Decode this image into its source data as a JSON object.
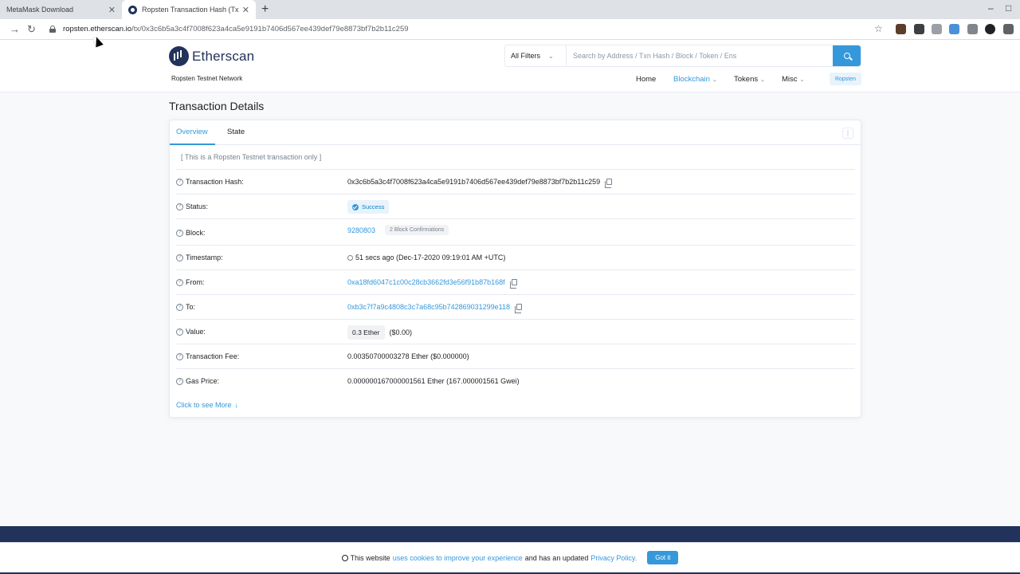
{
  "browser": {
    "tabs": [
      {
        "title": "MetaMask Download",
        "active": false
      },
      {
        "title": "Ropsten Transaction Hash (Txhas",
        "active": true
      }
    ],
    "url_host": "ropsten.etherscan.io",
    "url_path": "/tx/0x3c6b5a3c4f7008f623a4ca5e9191b7406d567ee439def79e8873bf7b2b11c259",
    "window_controls": [
      "–",
      "□"
    ]
  },
  "header": {
    "logo_text": "Etherscan",
    "network": "Ropsten Testnet Network",
    "filter_label": "All Filters",
    "search_placeholder": "Search by Address / Txn Hash / Block / Token / Ens",
    "nav": {
      "home": "Home",
      "blockchain": "Blockchain",
      "tokens": "Tokens",
      "misc": "Misc",
      "network_badge": "Ropsten"
    },
    "accent_color": "#3498db"
  },
  "page": {
    "title": "Transaction Details",
    "tabs": {
      "overview": "Overview",
      "state": "State"
    },
    "testnet_note": "[ This is a Ropsten Testnet transaction only ]",
    "fields": {
      "tx_hash_label": "Transaction Hash:",
      "tx_hash": "0x3c6b5a3c4f7008f623a4ca5e9191b7406d567ee439def79e8873bf7b2b11c259",
      "status_label": "Status:",
      "status": "Success",
      "block_label": "Block:",
      "block": "9280803",
      "confirmations": "2 Block Confirmations",
      "timestamp_label": "Timestamp:",
      "timestamp": "51 secs ago (Dec-17-2020 09:19:01 AM +UTC)",
      "from_label": "From:",
      "from": "0xa18fd6047c1c00c28cb3662fd3e56f91b87b168f",
      "to_label": "To:",
      "to": "0xb3c7f7a9c4808c3c7a68c95b742869031299e118",
      "value_label": "Value:",
      "value": "0.3 Ether",
      "value_usd": "($0.00)",
      "fee_label": "Transaction Fee:",
      "fee": "0.00350700003278 Ether ($0.000000)",
      "gas_label": "Gas Price:",
      "gas": "0.000000167000001561 Ether (167.000001561 Gwei)"
    },
    "see_more": "Click to see More"
  },
  "cookie": {
    "prefix": "This website",
    "link1": "uses cookies to improve your experience",
    "middle": "and has an updated",
    "link2": "Privacy Policy.",
    "button": "Got it"
  }
}
